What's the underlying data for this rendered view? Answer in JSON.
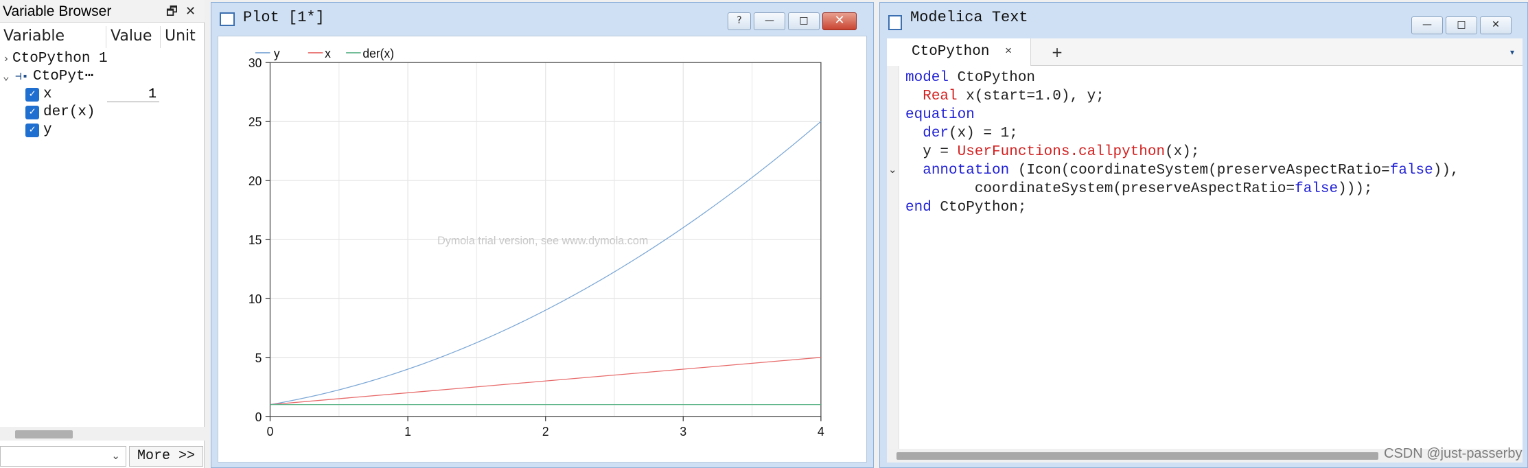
{
  "variable_browser": {
    "title": "Variable Browser",
    "columns": [
      "Variable",
      "Value",
      "Unit"
    ],
    "tree": [
      {
        "label": "CtoPython 1",
        "level": 0,
        "expanded": false
      },
      {
        "label": "CtoPyt⋯",
        "level": 0,
        "expanded": true
      },
      {
        "label": "x",
        "checked": true,
        "value": "1"
      },
      {
        "label": "der(x)",
        "checked": true
      },
      {
        "label": "y",
        "checked": true
      }
    ],
    "more_label": "More >>"
  },
  "plot_window": {
    "title": "Plot [1*]",
    "buttons": {
      "help": "?",
      "minimize": "—",
      "maximize": "□",
      "close": "✕"
    },
    "watermark": "Dymola trial version, see www.dymola.com"
  },
  "chart_data": {
    "type": "line",
    "xlim": [
      0,
      4
    ],
    "ylim": [
      0,
      30
    ],
    "x_ticks": [
      0,
      1,
      2,
      3,
      4
    ],
    "y_ticks": [
      0,
      5,
      10,
      15,
      20,
      25,
      30
    ],
    "grid": true,
    "legend": "top-left",
    "series": [
      {
        "name": "y",
        "color": "#7ba7d6",
        "x": [
          0,
          0.5,
          1,
          1.5,
          2,
          2.5,
          3,
          3.5,
          4
        ],
        "y": [
          1,
          2.25,
          4,
          6.25,
          9,
          12.25,
          16,
          20.25,
          25
        ]
      },
      {
        "name": "x",
        "color": "#e86a6a",
        "x": [
          0,
          4
        ],
        "y": [
          1,
          5
        ]
      },
      {
        "name": "der(x)",
        "color": "#5fb48a",
        "x": [
          0,
          4
        ],
        "y": [
          1,
          1
        ]
      }
    ]
  },
  "modelica_window": {
    "title": "Modelica Text",
    "tab": "CtoPython",
    "tab_close": "×",
    "tab_add": "+",
    "tab_menu": "▾",
    "code": [
      [
        {
          "t": "model",
          "c": "kw"
        },
        {
          "t": " CtoPython",
          "c": ""
        }
      ],
      [
        {
          "t": "  ",
          "c": ""
        },
        {
          "t": "Real",
          "c": "ty"
        },
        {
          "t": " x(start=1.0), y;",
          "c": ""
        }
      ],
      [
        {
          "t": "equation",
          "c": "kw"
        }
      ],
      [
        {
          "t": "  ",
          "c": ""
        },
        {
          "t": "der",
          "c": "kw"
        },
        {
          "t": "(x) = 1;",
          "c": ""
        }
      ],
      [
        {
          "t": "  y = ",
          "c": ""
        },
        {
          "t": "UserFunctions.callpython",
          "c": "fn"
        },
        {
          "t": "(x);",
          "c": ""
        }
      ],
      [
        {
          "t": "  ",
          "c": ""
        },
        {
          "t": "annotation",
          "c": "kw"
        },
        {
          "t": " (Icon(coordinateSystem(preserveAspectRatio=",
          "c": ""
        },
        {
          "t": "false",
          "c": "bl"
        },
        {
          "t": ")),",
          "c": ""
        }
      ],
      [
        {
          "t": "        coordinateSystem(preserveAspectRatio=",
          "c": ""
        },
        {
          "t": "false",
          "c": "bl"
        },
        {
          "t": ")));",
          "c": ""
        }
      ],
      [
        {
          "t": "end",
          "c": "kw"
        },
        {
          "t": " CtoPython;",
          "c": ""
        }
      ]
    ]
  },
  "watermark_csdn": "CSDN @just-passerby"
}
